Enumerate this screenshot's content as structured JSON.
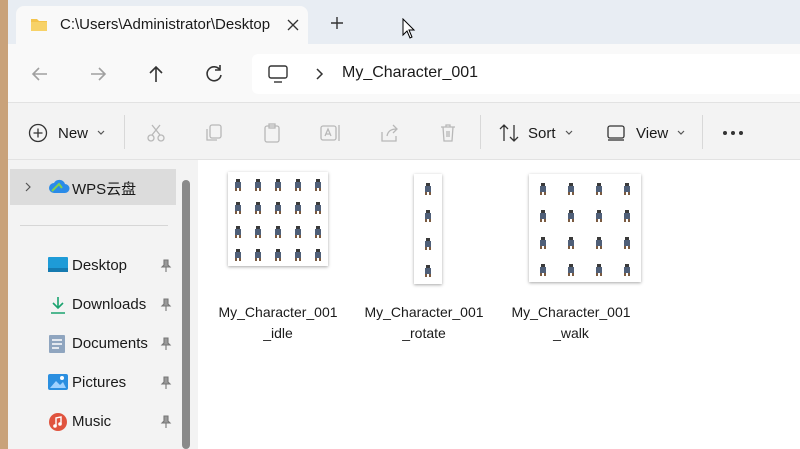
{
  "tab": {
    "title": "C:\\Users\\Administrator\\Desktop"
  },
  "address": {
    "crumb": "My_Character_001"
  },
  "toolbar": {
    "new_label": "New",
    "sort_label": "Sort",
    "view_label": "View"
  },
  "sidebar": {
    "top_item": "WPS云盘",
    "items": [
      {
        "label": "Desktop",
        "icon": "desktop-icon"
      },
      {
        "label": "Downloads",
        "icon": "download-icon"
      },
      {
        "label": "Documents",
        "icon": "documents-icon"
      },
      {
        "label": "Pictures",
        "icon": "pictures-icon"
      },
      {
        "label": "Music",
        "icon": "music-icon"
      }
    ]
  },
  "files": [
    {
      "name": "My_Character_001_idle",
      "sprite_rows": 4,
      "sprite_cols": 5
    },
    {
      "name": "My_Character_001_rotate",
      "sprite_rows": 4,
      "sprite_cols": 1
    },
    {
      "name": "My_Character_001_walk",
      "sprite_rows": 4,
      "sprite_cols": 4
    }
  ],
  "colors": {
    "accent": "#0067c0",
    "sprite": "#4f5f78",
    "folder": "#f4c44c"
  }
}
